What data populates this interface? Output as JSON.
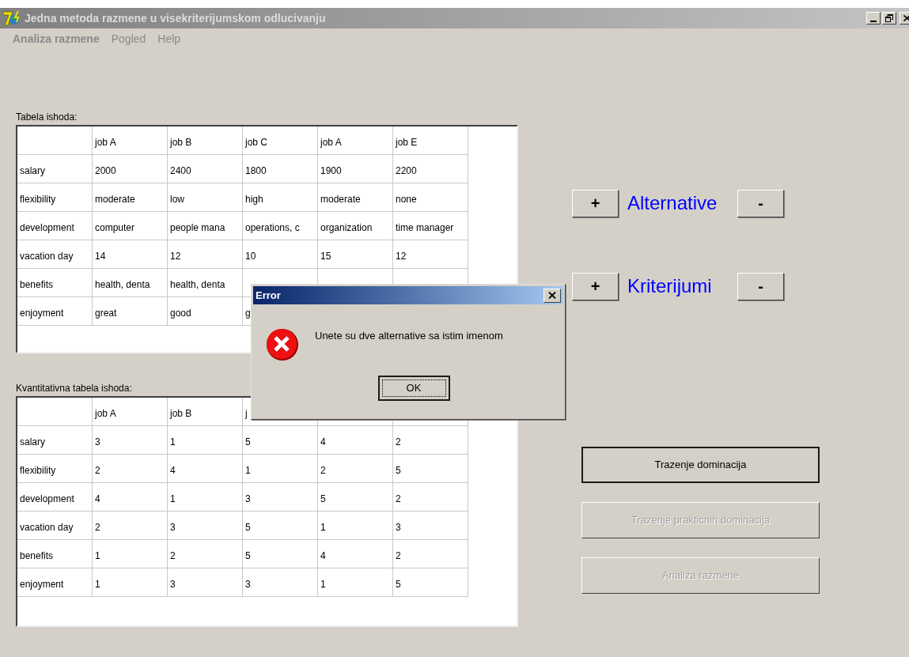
{
  "window": {
    "title": "Jedna metoda razmene u visekriterijumskom odlucivanju"
  },
  "menu": [
    {
      "label": "Analiza razmene",
      "selected": true
    },
    {
      "label": "Pogled",
      "selected": false
    },
    {
      "label": "Help",
      "selected": false
    }
  ],
  "outcome_table": {
    "label": "Tabela ishoda:",
    "columns": [
      "job A",
      "job B",
      "job C",
      "job A",
      "job E"
    ],
    "rows": [
      {
        "criterion": "salary",
        "cells": [
          "2000",
          "2400",
          "1800",
          "1900",
          "2200"
        ]
      },
      {
        "criterion": "flexibility",
        "cells": [
          "moderate",
          "low",
          "high",
          "moderate",
          "none"
        ]
      },
      {
        "criterion": "development",
        "cells": [
          "computer",
          "people mana",
          "operations, c",
          "organization",
          "time manager"
        ]
      },
      {
        "criterion": "vacation day",
        "cells": [
          "14",
          "12",
          "10",
          "15",
          "12"
        ]
      },
      {
        "criterion": "benefits",
        "cells": [
          "health, denta",
          "health, denta",
          null,
          null,
          null
        ]
      },
      {
        "criterion": "enjoyment",
        "cells": [
          "great",
          "good",
          "g",
          null,
          null
        ]
      }
    ]
  },
  "quantitative_table": {
    "label": "Kvantitativna tabela ishoda:",
    "columns": [
      "job A",
      "job B",
      "j",
      null,
      null
    ],
    "rows": [
      {
        "criterion": "salary",
        "cells": [
          "3",
          "1",
          "5",
          "4",
          "2"
        ]
      },
      {
        "criterion": "flexibility",
        "cells": [
          "2",
          "4",
          "1",
          "2",
          "5"
        ]
      },
      {
        "criterion": "development",
        "cells": [
          "4",
          "1",
          "3",
          "5",
          "2"
        ]
      },
      {
        "criterion": "vacation day",
        "cells": [
          "2",
          "3",
          "5",
          "1",
          "3"
        ]
      },
      {
        "criterion": "benefits",
        "cells": [
          "1",
          "2",
          "5",
          "4",
          "2"
        ]
      },
      {
        "criterion": "enjoyment",
        "cells": [
          "1",
          "3",
          "3",
          "1",
          "5"
        ]
      }
    ]
  },
  "editors": [
    {
      "add": "+",
      "label": "Alternative",
      "remove": "-"
    },
    {
      "add": "+",
      "label": "Kriterijumi",
      "remove": "-"
    }
  ],
  "actions": [
    {
      "label": "Trazenje dominacija",
      "disabled": false,
      "default": true
    },
    {
      "label": "Trazenje prakticnih dominacija",
      "disabled": true,
      "default": false
    },
    {
      "label": "Analiza razmene",
      "disabled": true,
      "default": false
    }
  ],
  "dialog": {
    "title": "Error",
    "message": "Unete su dve alternative sa istim imenom",
    "button": "OK"
  }
}
